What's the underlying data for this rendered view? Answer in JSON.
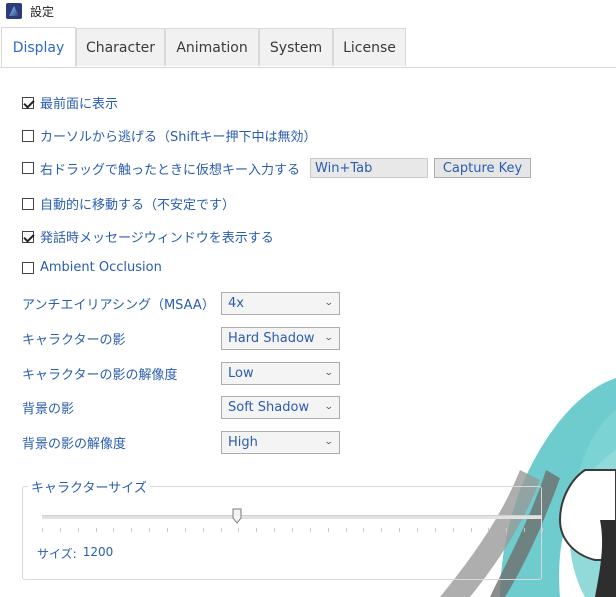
{
  "window": {
    "title": "設定"
  },
  "tabs": [
    {
      "label": "Display",
      "active": true
    },
    {
      "label": "Character",
      "active": false
    },
    {
      "label": "Animation",
      "active": false
    },
    {
      "label": "System",
      "active": false
    },
    {
      "label": "License",
      "active": false
    }
  ],
  "checkboxes": [
    {
      "label": "最前面に表示",
      "checked": true
    },
    {
      "label": "カーソルから逃げる（Shiftキー押下中は無効）",
      "checked": false
    },
    {
      "label": "右ドラッグで触ったときに仮想キー入力する",
      "checked": false
    },
    {
      "label": "自動的に移動する（不安定です）",
      "checked": false
    },
    {
      "label": "発話時メッセージウィンドウを表示する",
      "checked": true
    },
    {
      "label": "Ambient Occlusion",
      "checked": false
    }
  ],
  "virtual_key": {
    "value": "Win+Tab",
    "capture_label": "Capture Key"
  },
  "settings": [
    {
      "label": "アンチエイリアシング（MSAA）",
      "value": "4x"
    },
    {
      "label": "キャラクターの影",
      "value": "Hard Shadow"
    },
    {
      "label": "キャラクターの影の解像度",
      "value": "Low"
    },
    {
      "label": "背景の影",
      "value": "Soft Shadow"
    },
    {
      "label": "背景の影の解像度",
      "value": "High"
    }
  ],
  "character_size": {
    "group_label": "キャラクターサイズ",
    "size_label": "サイズ:",
    "size_value": "1200",
    "slider_level": 0.39
  },
  "colors": {
    "label_blue": "#2a5db0",
    "active_tab": "#2f68c8",
    "hair_teal": "#5fc6c9"
  }
}
